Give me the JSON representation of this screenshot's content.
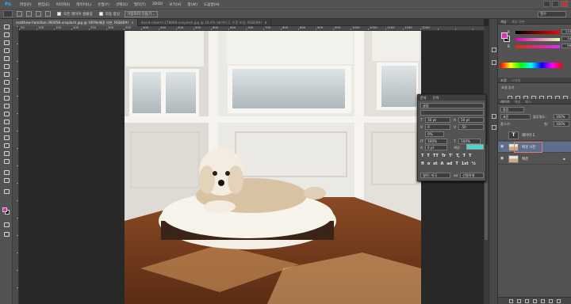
{
  "app": {
    "logo": "Ps",
    "menu": [
      "파일(F)",
      "편집(E)",
      "이미지(I)",
      "레이어(L)",
      "유형(Y)",
      "선택(S)",
      "필터(T)",
      "3D(D)",
      "보기(V)",
      "창(W)",
      "도움말(H)"
    ],
    "window_controls": [
      "minimize",
      "restore",
      "close"
    ]
  },
  "options_bar": {
    "checkbox1_label": "모든 레이어 샘플링",
    "checkbox2_label": "자동 향상",
    "button_label": "가장자리 다듬기...",
    "workspace": "필수"
  },
  "tabs": [
    {
      "label": "matthew-hamilton-392858-unsplash.jpg @ 100%(배경 사본, RGB/8#)",
      "active": true
    },
    {
      "label": "david-roberts-278696-unsplash.jpg @ 34.4% (레이어 2, 수준 조정, RGB/8#)",
      "active": false
    }
  ],
  "ruler_top_labels": [
    "50",
    "100",
    "150",
    "200",
    "250",
    "300",
    "350",
    "400",
    "450",
    "500",
    "550",
    "600",
    "650",
    "700",
    "750",
    "800",
    "850",
    "900",
    "950",
    "1000",
    "1050",
    "1100",
    "1150",
    "1200"
  ],
  "character_panel": {
    "tabs": [
      "문자",
      "단락"
    ],
    "font_family": "굴림",
    "font_style": "-",
    "font_size": "30 pt",
    "leading": "50 pt",
    "kerning": "0",
    "tracking": "-50",
    "vscale": "100%",
    "hscale": "100%",
    "baseline": "0 pt",
    "color_label": "색상:",
    "percent": "0%",
    "language": "영어: 미국",
    "antialias": "선명하게",
    "type_buttons": [
      "T",
      "T",
      "TT",
      "Tr",
      "T'",
      "T,",
      "T",
      "T"
    ],
    "text_color": "#48d6d0"
  },
  "color_panel": {
    "tabs": [
      "색상",
      "색상 견본"
    ],
    "r": "113",
    "g": "14",
    "b": "99",
    "fg_color": "#e12bb8",
    "bg_color": "#222222"
  },
  "adjustments_panel": {
    "tabs": [
      "조정",
      "스타일"
    ],
    "title": "조정 추가"
  },
  "layers_panel": {
    "tabs": [
      "레이어",
      "채널",
      "패스"
    ],
    "kind_filter": "종류",
    "blend_mode": "표준",
    "opacity_label": "불투명도:",
    "opacity": "100%",
    "lock_label": "잠그기:",
    "fill_label": "칠:",
    "fill": "100%",
    "layers": [
      {
        "name": "레이어 1",
        "type": "text",
        "visible": false,
        "active": false
      },
      {
        "name": "배경 사본",
        "type": "image",
        "visible": true,
        "active": true
      },
      {
        "name": "배경",
        "type": "image",
        "visible": true,
        "active": false
      }
    ]
  }
}
